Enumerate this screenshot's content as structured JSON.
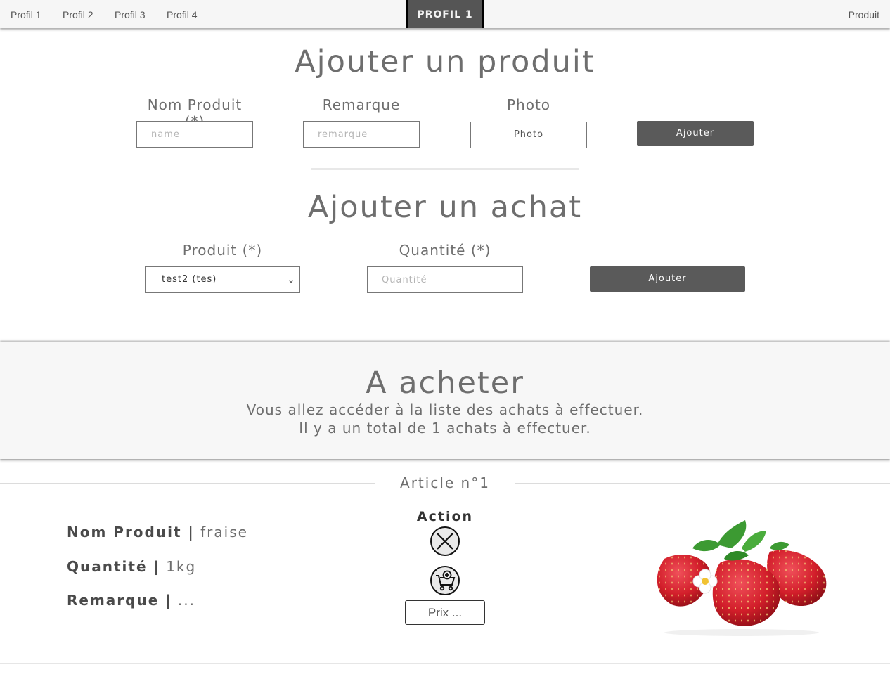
{
  "nav": {
    "profiles": [
      "Profil 1",
      "Profil 2",
      "Profil 3",
      "Profil 4"
    ],
    "active": "PROFIL 1",
    "right_link": "Produit"
  },
  "add_product": {
    "title": "Ajouter un produit",
    "name_label": "Nom Produit (*)",
    "name_placeholder": "name",
    "remark_label": "Remarque",
    "remark_placeholder": "remarque",
    "photo_label": "Photo",
    "photo_button": "Photo",
    "submit": "Ajouter"
  },
  "add_purchase": {
    "title": "Ajouter un achat",
    "product_label": "Produit (*)",
    "product_selected": "test2 (tes)",
    "qty_label": "Quantité (*)",
    "qty_placeholder": "Quantité",
    "submit": "Ajouter"
  },
  "to_buy": {
    "title": "A acheter",
    "line1": "Vous allez accéder à la liste des achats à effectuer.",
    "line2": "Il y a un total de 1 achats à effectuer."
  },
  "article": {
    "title": "Article n°1",
    "name_key": "Nom Produit |",
    "name_value": "fraise",
    "qty_key": "Quantité |",
    "qty_value": "1kg",
    "remark_key": "Remarque |",
    "remark_value": "...",
    "action_label": "Action",
    "price_button": "Prix ...",
    "delete_icon": "close-circle-icon",
    "cart_icon": "cart-add-icon",
    "image": "strawberries-photo"
  },
  "colors": {
    "nav_bg": "#f6f6f6",
    "active_tab": "#555555",
    "button_dark": "#5a5a5a",
    "text": "#6e6e6e",
    "banner_bg": "#f7f7f7"
  }
}
